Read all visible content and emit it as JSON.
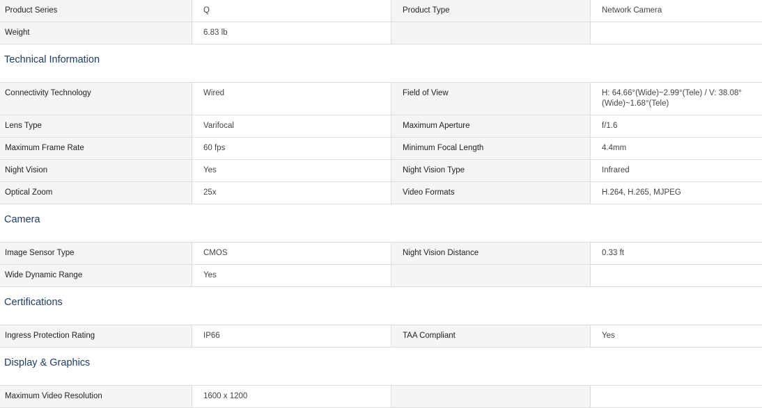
{
  "general": {
    "rows": [
      [
        "Product Series",
        "Q",
        "Product Type",
        "Network Camera"
      ],
      [
        "Weight",
        "6.83 lb",
        "",
        ""
      ]
    ]
  },
  "technical": {
    "title": "Technical Information",
    "rows": [
      [
        "Connectivity Technology",
        "Wired",
        "Field of View",
        "H: 64.66°(Wide)~2.99°(Tele) / V: 38.08°(Wide)~1.68°(Tele)"
      ],
      [
        "Lens Type",
        "Varifocal",
        "Maximum Aperture",
        "f/1.6"
      ],
      [
        "Maximum Frame Rate",
        "60 fps",
        "Minimum Focal Length",
        "4.4mm"
      ],
      [
        "Night Vision",
        "Yes",
        "Night Vision Type",
        "Infrared"
      ],
      [
        "Optical Zoom",
        "25x",
        "Video Formats",
        "H.264, H.265, MJPEG"
      ]
    ]
  },
  "camera": {
    "title": "Camera",
    "rows": [
      [
        "Image Sensor Type",
        "CMOS",
        "Night Vision Distance",
        "0.33 ft"
      ],
      [
        "Wide Dynamic Range",
        "Yes",
        "",
        ""
      ]
    ]
  },
  "certifications": {
    "title": "Certifications",
    "rows": [
      [
        "Ingress Protection Rating",
        "IP66",
        "TAA Compliant",
        "Yes"
      ]
    ]
  },
  "display": {
    "title": "Display & Graphics",
    "rows": [
      [
        "Maximum Video Resolution",
        "1600 x 1200",
        "",
        ""
      ]
    ]
  }
}
